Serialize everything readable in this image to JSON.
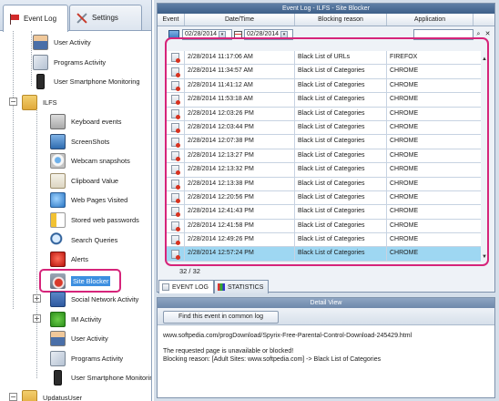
{
  "tabs": {
    "event_log": "Event Log",
    "settings": "Settings"
  },
  "tree": {
    "items": [
      {
        "label": "User Activity",
        "icon": "user-activity-icon"
      },
      {
        "label": "Programs Activity",
        "icon": "programs-activity-icon"
      },
      {
        "label": "User Smartphone Monitoring",
        "icon": "smartphone-icon"
      },
      {
        "label": "ILFS",
        "icon": "user-folder-icon"
      },
      {
        "label": "Keyboard events",
        "icon": "keyboard-icon"
      },
      {
        "label": "ScreenShots",
        "icon": "screenshot-icon"
      },
      {
        "label": "Webcam snapshots",
        "icon": "webcam-icon"
      },
      {
        "label": "Clipboard Value",
        "icon": "clipboard-icon"
      },
      {
        "label": "Web Pages Visited",
        "icon": "globe-icon"
      },
      {
        "label": "Stored web passwords",
        "icon": "password-icon"
      },
      {
        "label": "Search Queries",
        "icon": "search-icon"
      },
      {
        "label": "Alerts",
        "icon": "alert-icon"
      },
      {
        "label": "Site Blocker",
        "icon": "site-blocker-icon"
      },
      {
        "label": "Social Network Activity",
        "icon": "social-network-icon"
      },
      {
        "label": "IM Activity",
        "icon": "im-icon"
      },
      {
        "label": "User Activity",
        "icon": "user-activity-icon"
      },
      {
        "label": "Programs Activity",
        "icon": "programs-activity-icon"
      },
      {
        "label": "User Smartphone Monitoring",
        "icon": "smartphone-icon"
      },
      {
        "label": "UpdatusUser",
        "icon": "user-folder-icon"
      }
    ]
  },
  "log": {
    "title": "Event Log - ILFS - Site Blocker",
    "columns": [
      "Event",
      "Date/Time",
      "Blocking reason",
      "Application"
    ],
    "filter": {
      "date_from": "02/28/2014",
      "date_to": "02/28/2014",
      "search_value": ""
    },
    "rows": [
      {
        "datetime": "2/28/2014 11:17:06 AM",
        "reason": "Black List of URLs",
        "app": "FIREFOX"
      },
      {
        "datetime": "2/28/2014 11:34:57 AM",
        "reason": "Black List of Categories",
        "app": "CHROME"
      },
      {
        "datetime": "2/28/2014 11:41:12 AM",
        "reason": "Black List of Categories",
        "app": "CHROME"
      },
      {
        "datetime": "2/28/2014 11:53:18 AM",
        "reason": "Black List of Categories",
        "app": "CHROME"
      },
      {
        "datetime": "2/28/2014 12:03:26 PM",
        "reason": "Black List of Categories",
        "app": "CHROME"
      },
      {
        "datetime": "2/28/2014 12:03:44 PM",
        "reason": "Black List of Categories",
        "app": "CHROME"
      },
      {
        "datetime": "2/28/2014 12:07:38 PM",
        "reason": "Black List of Categories",
        "app": "CHROME"
      },
      {
        "datetime": "2/28/2014 12:13:27 PM",
        "reason": "Black List of Categories",
        "app": "CHROME"
      },
      {
        "datetime": "2/28/2014 12:13:32 PM",
        "reason": "Black List of Categories",
        "app": "CHROME"
      },
      {
        "datetime": "2/28/2014 12:13:38 PM",
        "reason": "Black List of Categories",
        "app": "CHROME"
      },
      {
        "datetime": "2/28/2014 12:20:56 PM",
        "reason": "Black List of Categories",
        "app": "CHROME"
      },
      {
        "datetime": "2/28/2014 12:41:43 PM",
        "reason": "Black List of Categories",
        "app": "CHROME"
      },
      {
        "datetime": "2/28/2014 12:41:58 PM",
        "reason": "Black List of Categories",
        "app": "CHROME"
      },
      {
        "datetime": "2/28/2014 12:49:26 PM",
        "reason": "Black List of Categories",
        "app": "CHROME"
      },
      {
        "datetime": "2/28/2014 12:57:24 PM",
        "reason": "Black List of Categories",
        "app": "CHROME",
        "selected": true
      }
    ],
    "count": "32 / 32",
    "subtabs": {
      "event_log": "EVENT LOG",
      "statistics": "STATISTICS"
    }
  },
  "detail": {
    "title": "Detail View",
    "find_button": "Find this event in common log",
    "text": "www.softpedia.com/progDownload/Spyrix-Free-Parental-Control-Download-245429.html\n\nThe requested page is unavailable or blocked!\nBlocking reason: [Adult Sites: www.softpedia.com] -> Black List of Categories"
  },
  "colors": {
    "accent_highlight": "#d6247a",
    "selected_row": "#9ed7f2",
    "title_bar": "#4f6f98",
    "tree_selection": "#3d8fe0"
  }
}
